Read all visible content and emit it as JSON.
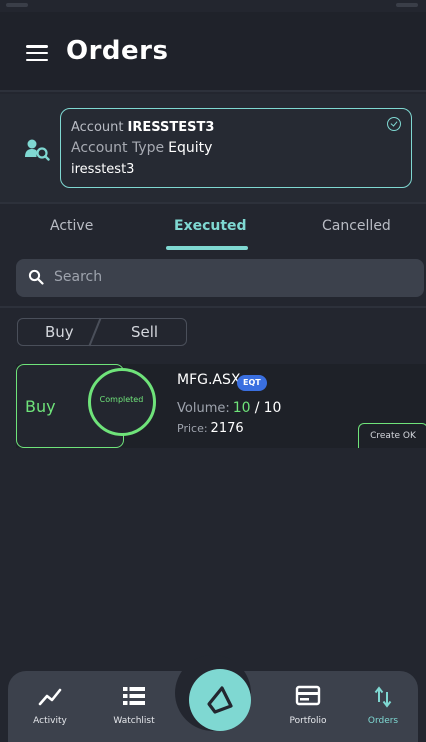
{
  "header": {
    "title": "Orders",
    "menu_icon": "menu-icon"
  },
  "account": {
    "account_label": "Account",
    "account_value": "IRESSTEST3",
    "type_label": "Account Type",
    "type_value": "Equity",
    "user": "iresstest3"
  },
  "tabs": [
    {
      "label": "Active",
      "active": false
    },
    {
      "label": "Executed",
      "active": true
    },
    {
      "label": "Cancelled",
      "active": false
    }
  ],
  "search": {
    "placeholder": "Search"
  },
  "filters": {
    "buy": "Buy",
    "sell": "Sell"
  },
  "order": {
    "side": "Buy",
    "status": "Completed",
    "symbol": "MFG.ASX",
    "badge": "EQT",
    "volume_label": "Volume:",
    "volume_filled": "10",
    "volume_sep": "/",
    "volume_total": "10",
    "price_label": "Price:",
    "price_value": "2176",
    "action": "Create OK"
  },
  "nav": [
    {
      "label": "Activity",
      "icon": "activity-chart-icon"
    },
    {
      "label": "Watchlist",
      "icon": "list-icon"
    },
    {
      "label": "Portfolio",
      "icon": "portfolio-icon"
    },
    {
      "label": "Orders",
      "icon": "orders-arrows-icon",
      "active": true
    }
  ],
  "colors": {
    "background": "#23262f",
    "accent": "#7fd8d2",
    "buy_green": "#6fe37a",
    "badge_blue": "#3a6fe0",
    "nav_bg": "#3c414c"
  }
}
